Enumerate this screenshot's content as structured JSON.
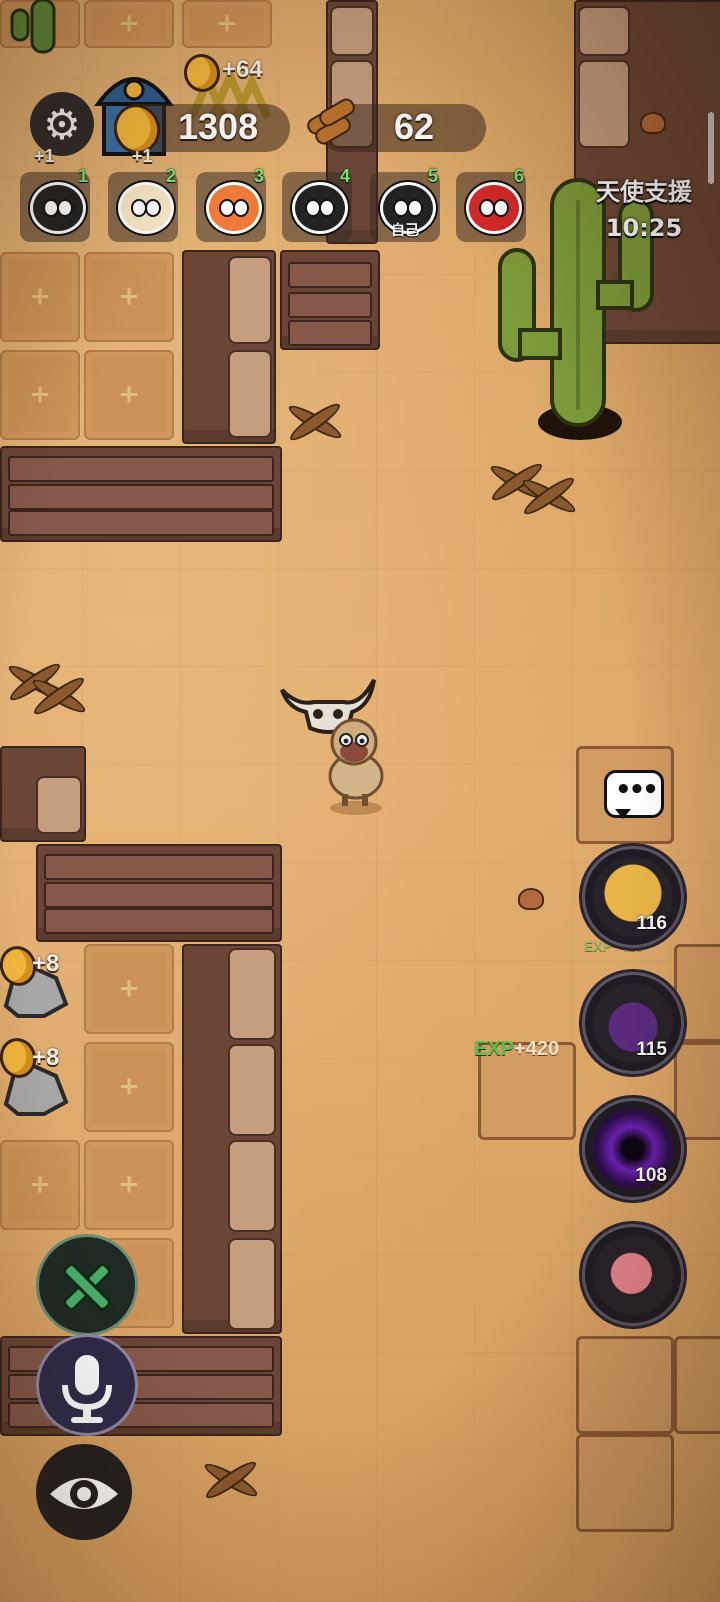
{
  "hud": {
    "coins": "1308",
    "wood": "62",
    "coin_gain": "+64"
  },
  "players": [
    {
      "num": "1",
      "tag": "",
      "kind": "dark",
      "gain": "+1"
    },
    {
      "num": "2",
      "tag": "",
      "kind": "sheep",
      "gain": "+1"
    },
    {
      "num": "3",
      "tag": "",
      "kind": "tiger"
    },
    {
      "num": "4",
      "tag": "",
      "kind": "dark"
    },
    {
      "num": "5",
      "tag": "自己",
      "kind": "dark"
    },
    {
      "num": "6",
      "tag": "",
      "kind": "red"
    }
  ],
  "angel_support": {
    "label": "天使支援",
    "timer": "10:25"
  },
  "skills": [
    {
      "name": "piggy-bank",
      "count": "116"
    },
    {
      "name": "potion",
      "count": "115"
    },
    {
      "name": "vortex",
      "count": "108"
    },
    {
      "name": "meat",
      "count": ""
    }
  ],
  "exp_popups": [
    {
      "label": "EXP",
      "value": "+420"
    },
    {
      "label": "EXP",
      "value": "+420"
    }
  ],
  "ore_gains": [
    "+8",
    "+8"
  ],
  "colors": {
    "sand": "#dba768",
    "wall": "#6b4636",
    "exp_green": "#5fbf4f",
    "player_num_green": "#7be36b"
  }
}
